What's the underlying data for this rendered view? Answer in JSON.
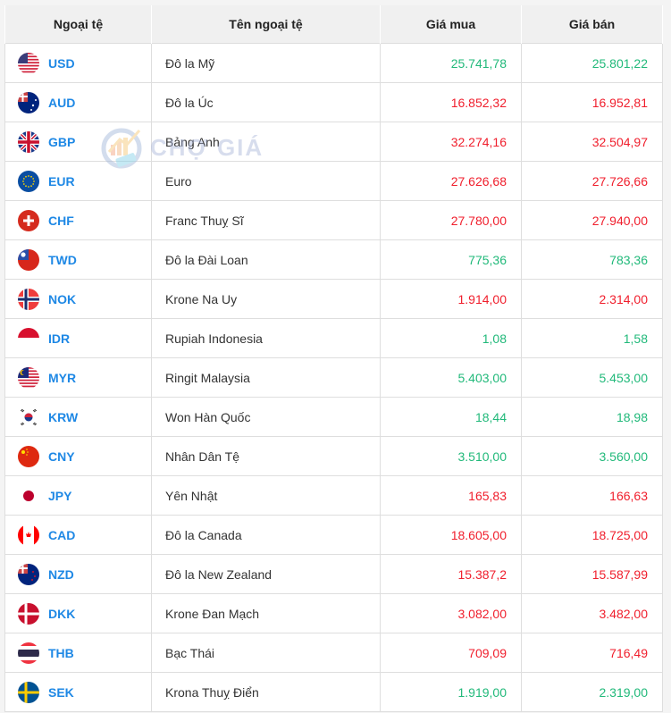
{
  "table": {
    "headers": {
      "code": "Ngoại tệ",
      "name": "Tên ngoại tệ",
      "buy": "Giá mua",
      "sell": "Giá bán"
    },
    "rows": [
      {
        "code": "USD",
        "name": "Đô la Mỹ",
        "buy": "25.741,78",
        "sell": "25.801,22",
        "trend": "up",
        "flag": "us-flag-icon"
      },
      {
        "code": "AUD",
        "name": "Đô la Úc",
        "buy": "16.852,32",
        "sell": "16.952,81",
        "trend": "down",
        "flag": "au-flag-icon"
      },
      {
        "code": "GBP",
        "name": "Bảng Anh",
        "buy": "32.274,16",
        "sell": "32.504,97",
        "trend": "down",
        "flag": "gb-flag-icon"
      },
      {
        "code": "EUR",
        "name": "Euro",
        "buy": "27.626,68",
        "sell": "27.726,66",
        "trend": "down",
        "flag": "eu-flag-icon"
      },
      {
        "code": "CHF",
        "name": "Franc Thuỵ Sĩ",
        "buy": "27.780,00",
        "sell": "27.940,00",
        "trend": "down",
        "flag": "ch-flag-icon"
      },
      {
        "code": "TWD",
        "name": "Đô la Đài Loan",
        "buy": "775,36",
        "sell": "783,36",
        "trend": "up",
        "flag": "tw-flag-icon"
      },
      {
        "code": "NOK",
        "name": "Krone Na Uy",
        "buy": "1.914,00",
        "sell": "2.314,00",
        "trend": "down",
        "flag": "no-flag-icon"
      },
      {
        "code": "IDR",
        "name": "Rupiah Indonesia",
        "buy": "1,08",
        "sell": "1,58",
        "trend": "up",
        "flag": "id-flag-icon"
      },
      {
        "code": "MYR",
        "name": "Ringit Malaysia",
        "buy": "5.403,00",
        "sell": "5.453,00",
        "trend": "up",
        "flag": "my-flag-icon"
      },
      {
        "code": "KRW",
        "name": "Won Hàn Quốc",
        "buy": "18,44",
        "sell": "18,98",
        "trend": "up",
        "flag": "kr-flag-icon"
      },
      {
        "code": "CNY",
        "name": "Nhân Dân Tệ",
        "buy": "3.510,00",
        "sell": "3.560,00",
        "trend": "up",
        "flag": "cn-flag-icon"
      },
      {
        "code": "JPY",
        "name": "Yên Nhật",
        "buy": "165,83",
        "sell": "166,63",
        "trend": "down",
        "flag": "jp-flag-icon"
      },
      {
        "code": "CAD",
        "name": "Đô la Canada",
        "buy": "18.605,00",
        "sell": "18.725,00",
        "trend": "down",
        "flag": "ca-flag-icon"
      },
      {
        "code": "NZD",
        "name": "Đô la New Zealand",
        "buy": "15.387,2",
        "sell": "15.587,99",
        "trend": "down",
        "flag": "nz-flag-icon"
      },
      {
        "code": "DKK",
        "name": "Krone Đan Mạch",
        "buy": "3.082,00",
        "sell": "3.482,00",
        "trend": "down",
        "flag": "dk-flag-icon"
      },
      {
        "code": "THB",
        "name": "Bạc Thái",
        "buy": "709,09",
        "sell": "716,49",
        "trend": "down",
        "flag": "th-flag-icon"
      },
      {
        "code": "SEK",
        "name": "Krona Thuỵ Điển",
        "buy": "1.919,00",
        "sell": "2.319,00",
        "trend": "up",
        "flag": "se-flag-icon"
      }
    ]
  },
  "watermark": {
    "text": "CHỢ GIÁ"
  },
  "colors": {
    "up": "#21b97a",
    "down": "#f01e2c",
    "code": "#1e88e5",
    "header_bg": "#f0f0f0"
  }
}
